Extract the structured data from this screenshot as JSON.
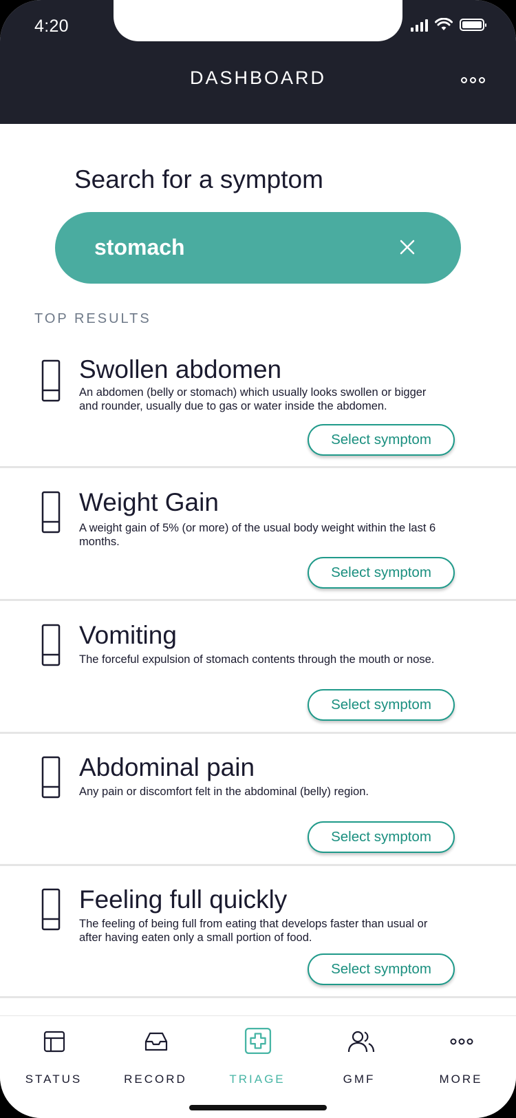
{
  "status_bar": {
    "time": "4:20"
  },
  "header": {
    "title": "DASHBOARD",
    "more_icon": "more-dots-icon"
  },
  "search": {
    "heading": "Search for a symptom",
    "value": "stomach",
    "placeholder": "",
    "clear_icon": "close-icon"
  },
  "results_label": "TOP RESULTS",
  "results": [
    {
      "title": "Swollen abdomen",
      "description": "An abdomen (belly or stomach) which usually looks swollen or bigger and rounder, usually due to gas or water inside the abdomen.",
      "button": "Select symptom"
    },
    {
      "title": "Weight Gain",
      "description": "A weight gain of 5% (or more) of the usual body weight within the last 6 months.",
      "button": "Select symptom"
    },
    {
      "title": "Vomiting",
      "description": "The forceful expulsion of stomach contents through the mouth or nose.",
      "button": "Select symptom"
    },
    {
      "title": "Abdominal pain",
      "description": "Any pain or discomfort felt in the abdominal (belly) region.",
      "button": "Select symptom"
    },
    {
      "title": "Feeling full quickly",
      "description": "The feeling of being full from eating that develops faster than usual or after having eaten only a small portion of food.",
      "button": "Select symptom"
    }
  ],
  "nav": [
    {
      "label": "STATUS",
      "icon": "layout-icon",
      "active": false
    },
    {
      "label": "RECORD",
      "icon": "inbox-icon",
      "active": false
    },
    {
      "label": "TRIAGE",
      "icon": "medical-cross-icon",
      "active": true
    },
    {
      "label": "GMF",
      "icon": "users-icon",
      "active": false
    },
    {
      "label": "MORE",
      "icon": "more-dots-icon",
      "active": false
    }
  ],
  "colors": {
    "header_bg": "#1f212c",
    "accent": "#4aaca0",
    "button_border": "#1f9a8a",
    "nav_active": "#47b5a5",
    "text_dark": "#1a1a2e"
  }
}
